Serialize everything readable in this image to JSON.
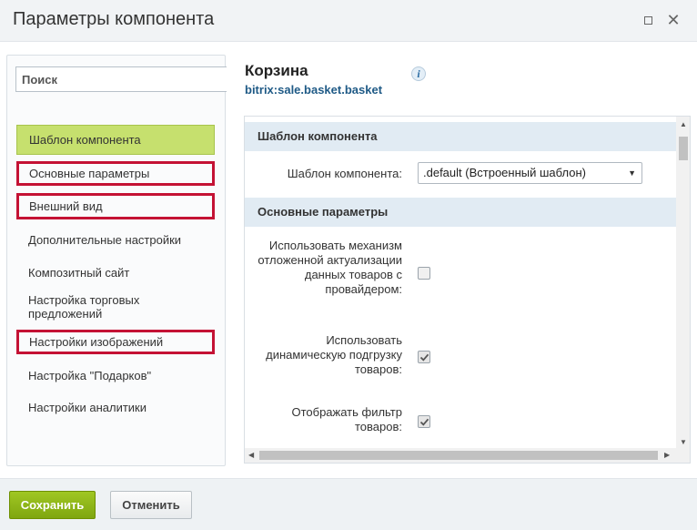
{
  "dialog": {
    "title": "Параметры компонента"
  },
  "sidebar": {
    "search_placeholder": "Поиск",
    "items": [
      {
        "label": "Шаблон компонента",
        "state": "active"
      },
      {
        "label": "Основные параметры",
        "state": "highlighted"
      },
      {
        "label": "Внешний вид",
        "state": "highlighted"
      },
      {
        "label": "Дополнительные настройки",
        "state": "normal"
      },
      {
        "label": "Композитный сайт",
        "state": "normal"
      },
      {
        "label": "Настройка торговых предложений",
        "state": "normal"
      },
      {
        "label": "Настройки изображений",
        "state": "highlighted"
      },
      {
        "label": "Настройка \"Подарков\"",
        "state": "normal"
      },
      {
        "label": "Настройки аналитики",
        "state": "normal"
      }
    ]
  },
  "component": {
    "name": "Корзина",
    "code": "bitrix:sale.basket.basket",
    "info_icon": "info-icon"
  },
  "sections": {
    "template": {
      "header": "Шаблон компонента",
      "field_label": "Шаблон компонента:",
      "field_value": ".default (Встроенный шаблон)"
    },
    "main": {
      "header": "Основные параметры",
      "fields": [
        {
          "label": "Использовать механизм отложенной актуализации данных товаров с провайдером:",
          "checked": false
        },
        {
          "label": "Использовать динамическую подгрузку товаров:",
          "checked": true
        },
        {
          "label": "Отображать фильтр товаров:",
          "checked": true
        }
      ]
    }
  },
  "footer": {
    "save_label": "Сохранить",
    "cancel_label": "Отменить"
  },
  "colors": {
    "active_item": "#c6e06e",
    "highlight_border": "#c41234",
    "section_header_bg": "#e1ebf3",
    "save_button": "#86ad00",
    "component_code": "#1f5a86"
  }
}
